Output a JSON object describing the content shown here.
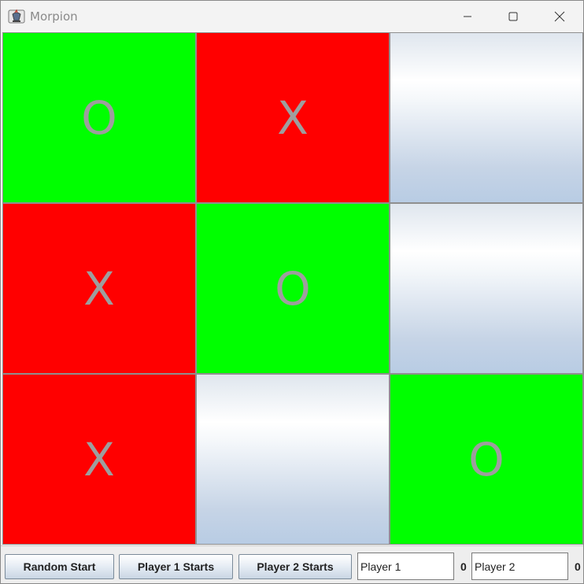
{
  "window": {
    "title": "Morpion",
    "icons": {
      "app": "java-cup-icon",
      "minimize": "minimize-icon",
      "maximize": "maximize-icon",
      "close": "close-icon"
    }
  },
  "board": {
    "cells": [
      {
        "mark": "O",
        "state": "o"
      },
      {
        "mark": "X",
        "state": "x"
      },
      {
        "mark": "",
        "state": "empty"
      },
      {
        "mark": "X",
        "state": "x"
      },
      {
        "mark": "O",
        "state": "o"
      },
      {
        "mark": "",
        "state": "empty"
      },
      {
        "mark": "X",
        "state": "x"
      },
      {
        "mark": "",
        "state": "empty"
      },
      {
        "mark": "O",
        "state": "o"
      }
    ],
    "colors": {
      "x_cell": "#ff0000",
      "o_cell": "#00ff00",
      "mark": "#9e9e9e"
    }
  },
  "controls": {
    "random_start": "Random Start",
    "player1_starts": "Player 1 Starts",
    "player2_starts": "Player 2 Starts",
    "player1": {
      "name": "Player 1",
      "score": "0"
    },
    "player2": {
      "name": "Player 2",
      "score": "0"
    }
  }
}
